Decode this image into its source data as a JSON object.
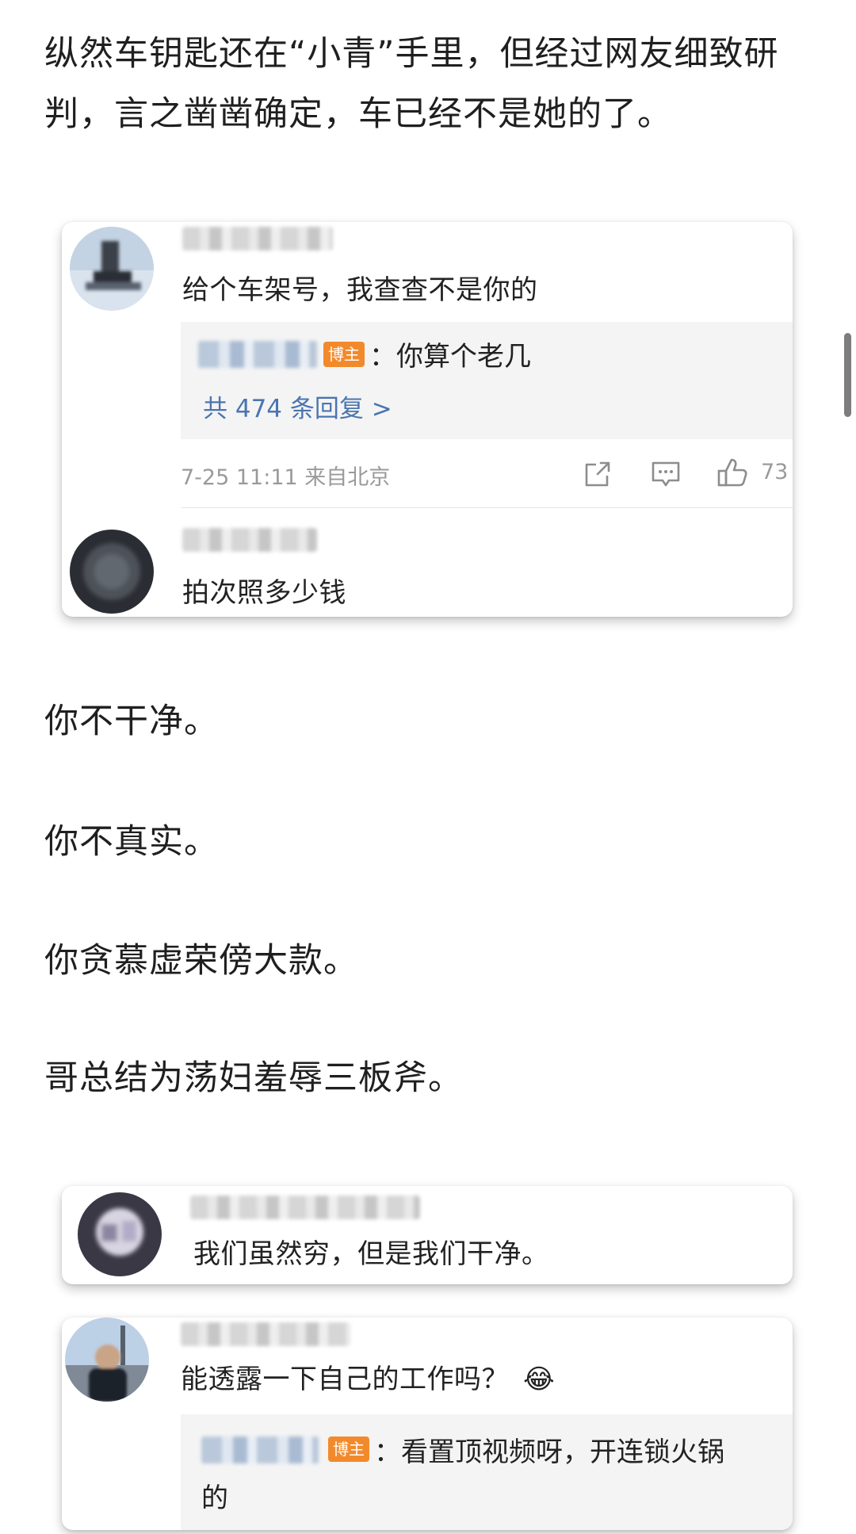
{
  "article": {
    "paragraph_1": "纵然车钥匙还在“小青”手里，但经过网友细致研判，言之凿凿确定，车已经不是她的了。",
    "line_1": "你不干净。",
    "line_2": "你不真实。",
    "line_3": "你贪慕虚荣傍大款。",
    "line_4": "哥总结为荡妇羞辱三板斧。"
  },
  "card_1": {
    "comment_1": {
      "text": "给个车架号，我查查不是你的",
      "reply": {
        "badge": "博主",
        "text": "：你算个老几"
      },
      "reply_count": "共 474 条回复 >",
      "meta": "7-25 11:11  来自北京",
      "like_count": "73",
      "icons": [
        "share-icon",
        "comment-icon",
        "like-icon"
      ]
    },
    "comment_2": {
      "text": "拍次照多少钱"
    }
  },
  "card_2": {
    "comment": {
      "text": "我们虽然穷，但是我们干净。"
    }
  },
  "card_3": {
    "comment": {
      "text": "能透露一下自己的工作吗？",
      "emoji": "😂",
      "reply": {
        "badge": "博主",
        "text_line_1": "：看置顶视频呀，开连锁火锅",
        "text_line_2": "的"
      }
    }
  },
  "colors": {
    "link_blue": "#4a75b0",
    "badge_orange": "#f28a2c",
    "meta_gray": "#9a9a9a",
    "reply_bg": "#f4f4f4"
  }
}
